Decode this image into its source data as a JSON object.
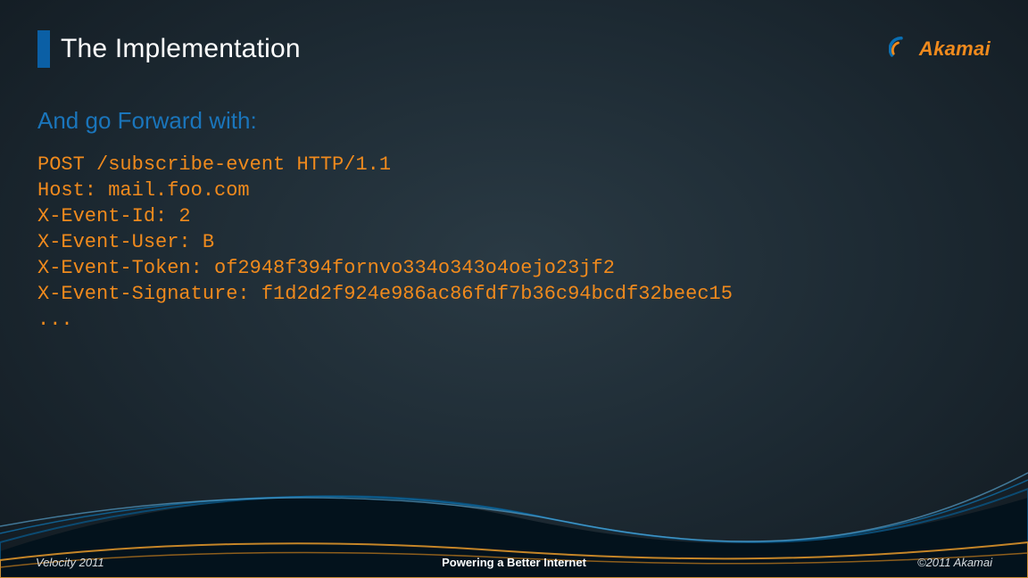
{
  "header": {
    "title": "The Implementation",
    "logo_text": "Akamai"
  },
  "subhead": "And go Forward with:",
  "code": "POST /subscribe-event HTTP/1.1\nHost: mail.foo.com\nX-Event-Id: 2\nX-Event-User: B\nX-Event-Token: of2948f394fornvo334o343o4oejo23jf2\nX-Event-Signature: f1d2d2f924e986ac86fdf7b36c94bcdf32beec15\n...",
  "footer": {
    "left": "Velocity 2011",
    "center": "Powering a Better Internet",
    "right": "©2011 Akamai"
  }
}
